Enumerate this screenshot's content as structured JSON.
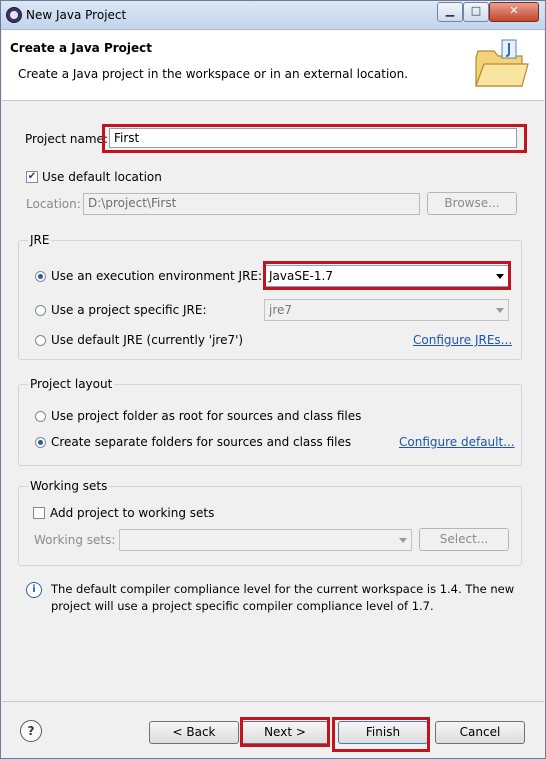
{
  "window": {
    "title": "New Java Project",
    "minimize": "▁",
    "maximize": "□",
    "close": "✕"
  },
  "header": {
    "title": "Create a Java Project",
    "description": "Create a Java project in the workspace or in an external location."
  },
  "project": {
    "name_label": "Project name:",
    "name_value": "First",
    "use_default_location_label": "Use default location",
    "use_default_location_checked": true,
    "location_label": "Location:",
    "location_value": "D:\\project\\First",
    "browse_label": "Browse..."
  },
  "jre": {
    "group_label": "JRE",
    "option_env_label": "Use an execution environment JRE:",
    "option_env_value": "JavaSE-1.7",
    "option_specific_label": "Use a project specific JRE:",
    "option_specific_value": "jre7",
    "option_default_label": "Use default JRE (currently 'jre7')",
    "configure_link": "Configure JREs...",
    "selected": "env"
  },
  "layout": {
    "group_label": "Project layout",
    "option_root_label": "Use project folder as root for sources and class files",
    "option_separate_label": "Create separate folders for sources and class files",
    "configure_link": "Configure default...",
    "selected": "separate"
  },
  "working_sets": {
    "group_label": "Working sets",
    "add_label": "Add project to working sets",
    "add_checked": false,
    "sets_label": "Working sets:",
    "sets_value": "",
    "select_label": "Select..."
  },
  "info": {
    "message_line1": "The default compiler compliance level for the current workspace is 1.4. The new",
    "message_line2": "project will use a project specific compiler compliance level of 1.7."
  },
  "footer": {
    "help": "?",
    "back_label": "< Back",
    "next_label": "Next >",
    "finish_label": "Finish",
    "cancel_label": "Cancel"
  },
  "colors": {
    "highlight": "#c0141f",
    "link": "#1d56b0",
    "window_frame": "#6a7d95"
  }
}
